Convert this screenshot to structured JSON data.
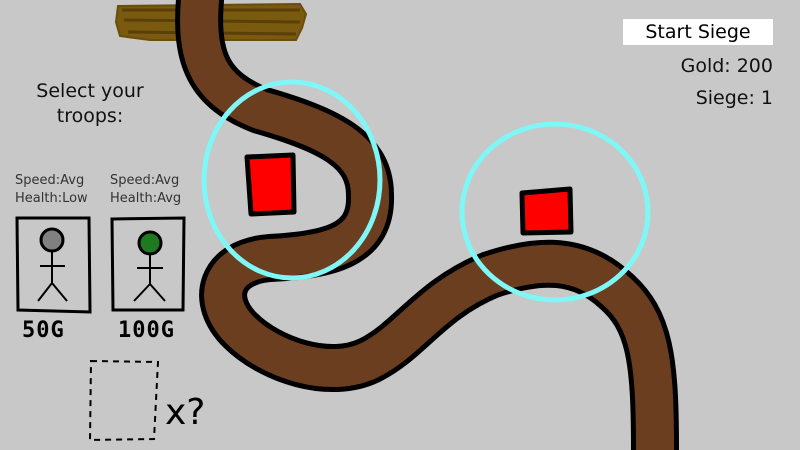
{
  "hud": {
    "start_button_label": "Start Siege",
    "gold_text": "Gold: 200",
    "siege_text": "Siege: 1"
  },
  "shop": {
    "title": "Select your troops:",
    "troops": [
      {
        "speed_text": "Speed:Avg",
        "health_text": "Health:Low",
        "price_label": "50G",
        "head_color": "#808080"
      },
      {
        "speed_text": "Speed:Avg",
        "health_text": "Health:Avg",
        "price_label": "100G",
        "head_color": "#1f7a1f"
      }
    ],
    "locked_slot_label": "x?"
  },
  "map": {
    "path_color": "#6b3e1f",
    "base_color": "#7a5a0e",
    "tower_color": "#ff0000",
    "range_color": "#7ff7f7",
    "towers": [
      {
        "name": "tower-1"
      },
      {
        "name": "tower-2"
      }
    ]
  }
}
